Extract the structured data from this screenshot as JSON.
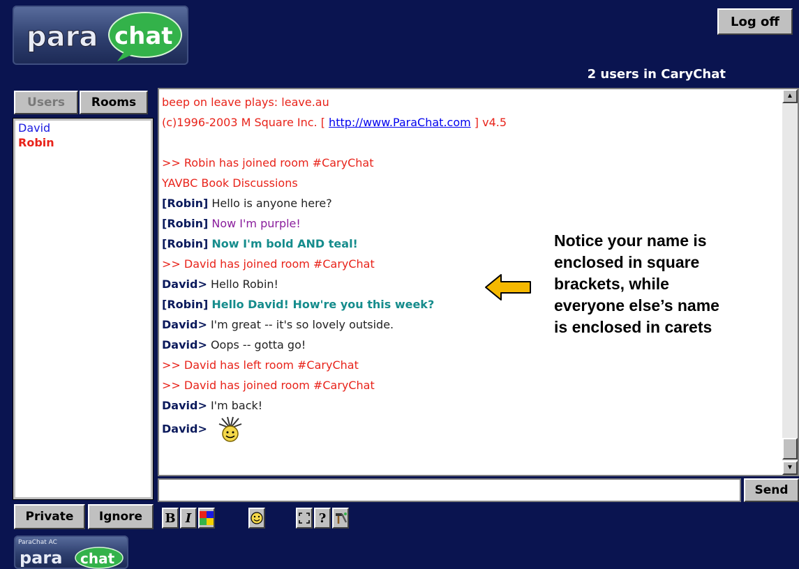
{
  "app": {
    "logo_text_left": "para",
    "logo_text_right": "chat",
    "logo_small_caption": "ParaChat AC",
    "logoff_label": "Log off",
    "user_count": "2 users in CaryChat"
  },
  "tabs": {
    "users": "Users",
    "rooms": "Rooms"
  },
  "users": [
    {
      "name": "David",
      "color": "#1a1ae0"
    },
    {
      "name": "Robin",
      "color": "#e8231a"
    }
  ],
  "chat": {
    "lines": [
      {
        "text": "beep on leave plays: leave.au"
      },
      {
        "pre": " (c)1996-2003 M Square Inc. [ ",
        "link": "http://www.ParaChat.com",
        "post": " ] v4.5"
      },
      {
        "text": ""
      },
      {
        "text": ">> Robin has joined room #CaryChat"
      },
      {
        "text": " YAVBC Book Discussions"
      },
      {
        "name": "[Robin]",
        "msg": "Hello is anyone here?"
      },
      {
        "name": "[Robin]",
        "msg": "Now I'm purple!"
      },
      {
        "name": "[Robin]",
        "msg": "Now I'm bold AND teal!"
      },
      {
        "text": ">> David has joined room #CaryChat"
      },
      {
        "name": "David>",
        "msg": "Hello Robin!"
      },
      {
        "name": "[Robin]",
        "msg": "Hello David!  How're you this week?"
      },
      {
        "name": "David>",
        "msg": "I'm great -- it's so lovely outside."
      },
      {
        "name": "David>",
        "msg": "Oops -- gotta go!"
      },
      {
        "text": ">> David has left room #CaryChat"
      },
      {
        "text": ">> David has joined room #CaryChat"
      },
      {
        "name": "David>",
        "msg": "I'm back!"
      },
      {
        "name": "David>",
        "msg": ""
      }
    ]
  },
  "input": {
    "value": "",
    "send_label": "Send"
  },
  "buttons": {
    "private": "Private",
    "ignore": "Ignore"
  },
  "toolbar": {
    "bold": "B",
    "italic": "I",
    "help": "?"
  },
  "annotation": "Notice your name is enclosed in square brackets, while everyone else’s name is enclosed in carets",
  "colors": {
    "background": "#0a1450",
    "system_text": "#e8231a",
    "name_text": "#0b1a5c",
    "teal": "#158c8c",
    "purple": "#8a1e9c",
    "arrow": "#f5b800"
  }
}
